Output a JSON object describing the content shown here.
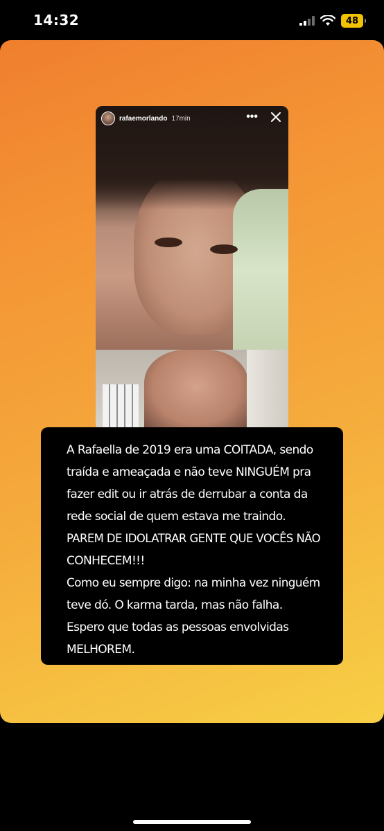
{
  "status_bar": {
    "time": "14:32",
    "battery": "48",
    "icons": [
      "cellular-signal-icon",
      "wifi-icon",
      "battery-icon"
    ]
  },
  "story": {
    "username": "rafaemorlando",
    "time_ago": "17min",
    "more_label": "•••",
    "caption_lines": [
      "A Rafaella de 2019 era uma COITADA, sendo",
      "traída e ameaçada e não teve NINGUÉM pra",
      "fazer edit ou ir atrás de derrubar a conta da",
      "rede social de quem estava me traindo.",
      "PAREM DE IDOLATRAR GENTE QUE VOCÊS NÃO",
      "CONHECEM!!!",
      "Como eu sempre digo: na minha vez ninguém",
      "teve dó. O karma tarda, mas não falha.",
      "Espero que todas as pessoas envolvidas",
      "MELHOREM."
    ]
  },
  "colors": {
    "gradient_start": "#f07f2e",
    "gradient_end": "#f7cf45",
    "battery": "#f2c200",
    "caption_background": "#000000"
  }
}
